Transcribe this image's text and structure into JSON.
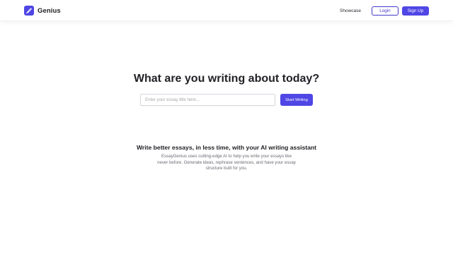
{
  "header": {
    "brand_name": "Genius",
    "nav": {
      "showcase_label": "Showcase",
      "login_label": "Login",
      "signup_label": "Sign Up"
    }
  },
  "hero": {
    "title": "What are you writing about today?",
    "input_placeholder": "Enter your essay title here...",
    "input_value": "",
    "button_label": "Start Writing"
  },
  "feature": {
    "title": "Write better essays, in less time, with your AI writing assistant",
    "description": "EssayGenius uses cutting-edge AI to help you write your essays like never before. Generate ideas, rephrase sentences, and have your essay structure built for you."
  },
  "icons": {
    "brand_logo": "feather-pen-icon"
  },
  "colors": {
    "accent": "#4f46e5",
    "accent_border": "#4338ca",
    "text_primary": "#222227",
    "text_muted": "#6b6b75"
  }
}
